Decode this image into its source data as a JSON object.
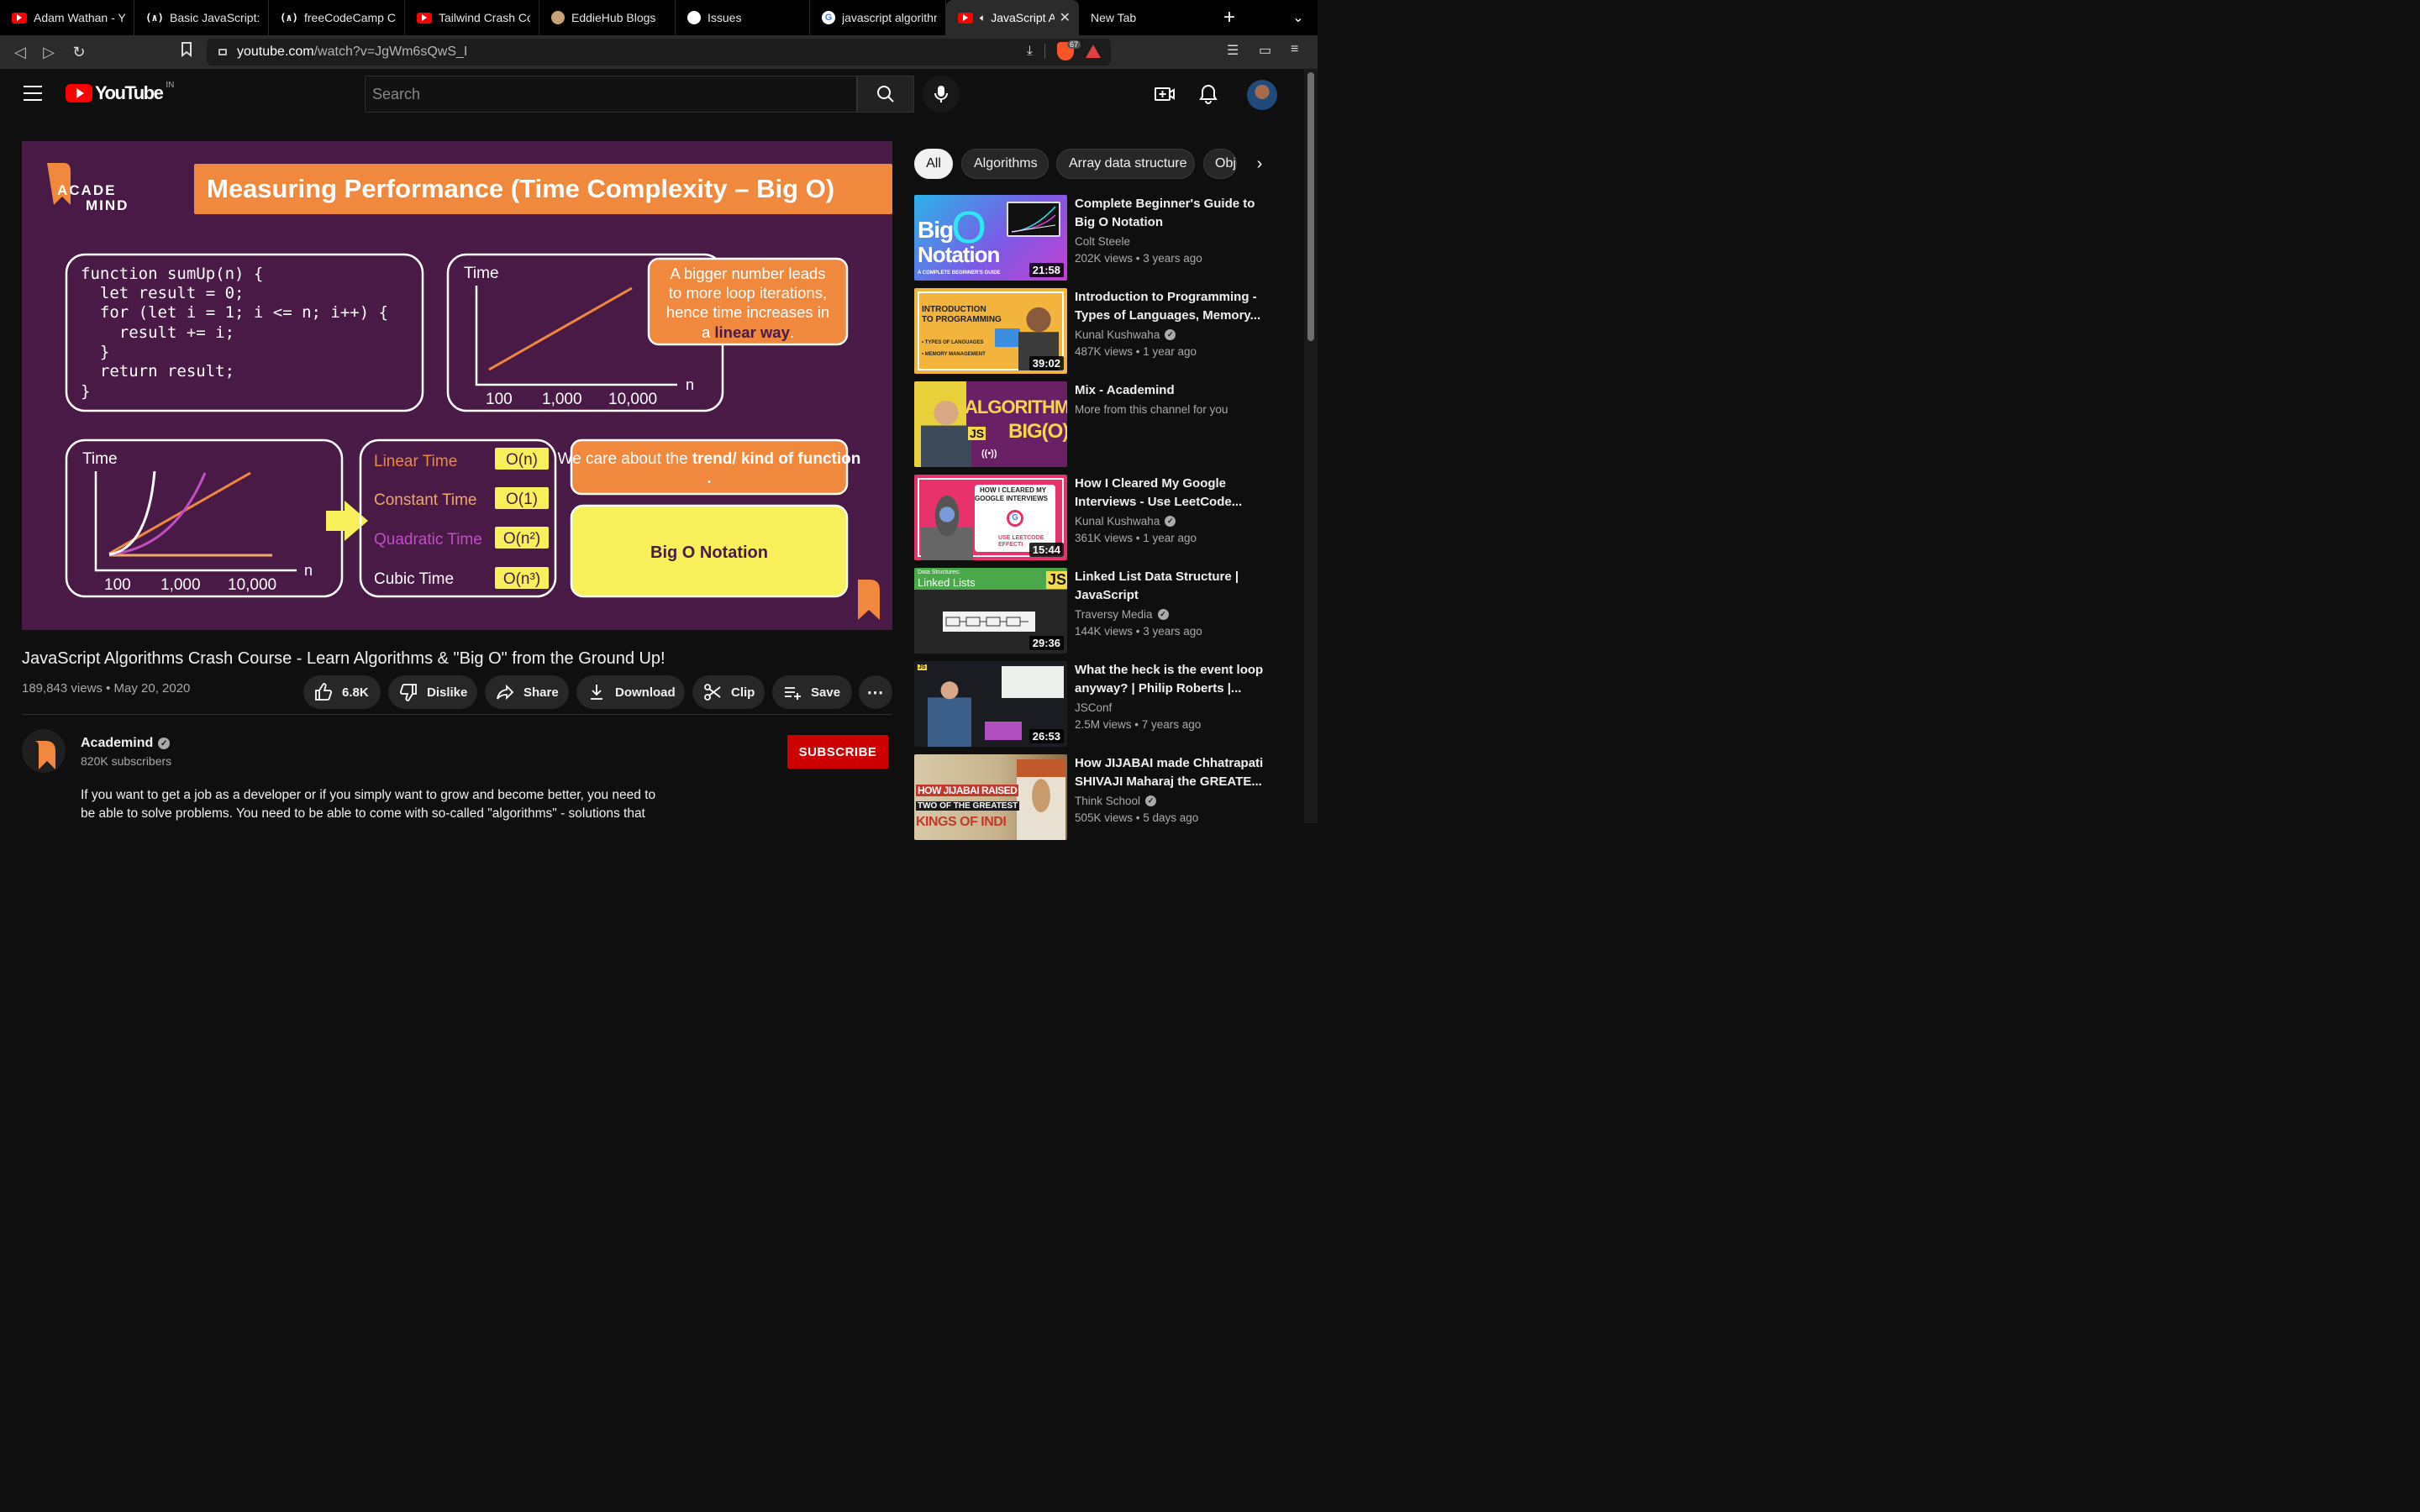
{
  "browser": {
    "tabs": [
      {
        "label": "Adam Wathan - You",
        "icon": "youtube-icon"
      },
      {
        "label": "Basic JavaScript: U",
        "icon": "freecodecamp-icon"
      },
      {
        "label": "freeCodeCamp Cha",
        "icon": "freecodecamp-icon"
      },
      {
        "label": "Tailwind Crash Cour",
        "icon": "youtube-icon"
      },
      {
        "label": "EddieHub Blogs",
        "icon": "eddiehub-icon"
      },
      {
        "label": "Issues",
        "icon": "github-icon"
      },
      {
        "label": "javascript algorithm",
        "icon": "google-icon"
      },
      {
        "label": "JavaScript A",
        "icon": "youtube-icon",
        "active": true
      },
      {
        "label": "New Tab",
        "icon": ""
      }
    ],
    "fcc_glyph": "(∧)",
    "url_host": "youtube.com",
    "url_path": "/watch?v=JgWm6sQwS_I",
    "shield_count": "67"
  },
  "youtube": {
    "logo_text": "YouTube",
    "country": "IN",
    "search_placeholder": "Search"
  },
  "video": {
    "slide": {
      "logo_line1": "ACADE",
      "logo_line2": "MIND",
      "heading": "Measuring Performance (Time Complexity – Big O)",
      "code": [
        "function sumUp(n) {",
        "  let result = 0;",
        "  for (let i = 1; i <= n; i++) {",
        "    result += i;",
        "  }",
        "  return result;",
        "}"
      ],
      "graph1": {
        "ylabel": "Time",
        "xlabel": "n",
        "ticks": [
          "100",
          "1,000",
          "10,000"
        ]
      },
      "note_lines": [
        "A bigger number leads",
        "to more loop iterations,",
        "hence time increases in",
        "a "
      ],
      "note_highlight": "linear way",
      "note_end": ".",
      "graph2": {
        "ylabel": "Time",
        "xlabel": "n",
        "ticks": [
          "100",
          "1,000",
          "10,000"
        ]
      },
      "complexities": [
        {
          "name": "Linear Time",
          "notation": "O(n)",
          "color": "#f0883e"
        },
        {
          "name": "Constant Time",
          "notation": "O(1)",
          "color": "#f0a868"
        },
        {
          "name": "Quadratic Time",
          "notation": "O(n²)",
          "color": "#c04fc4"
        },
        {
          "name": "Cubic Time",
          "notation": "O(n³)",
          "color": "#ffffff"
        }
      ],
      "care_prefix": "We care about the ",
      "care_bold": "trend/ kind of function",
      "care_end": ".",
      "bigo": "Big O Notation"
    },
    "title": "JavaScript Algorithms Crash Course - Learn Algorithms & \"Big O\" from the Ground Up!",
    "views": "189,843 views",
    "date": "May 20, 2020",
    "actions": {
      "likes": "6.8K",
      "dislike": "Dislike",
      "share": "Share",
      "download": "Download",
      "clip": "Clip",
      "save": "Save"
    },
    "channel": {
      "name": "Academind",
      "subscribers": "820K subscribers",
      "subscribe_label": "SUBSCRIBE"
    },
    "description_lines": [
      "If you want to get a job as a developer or if you simply want to grow and become better, you need to",
      "be able to solve problems. You need to be able to come with so-called \"algorithms\" - solutions that"
    ]
  },
  "chips": [
    "All",
    "Algorithms",
    "Array data structure",
    "Obj"
  ],
  "recommendations": [
    {
      "title": "Complete Beginner's Guide to Big O Notation",
      "channel": "Colt Steele",
      "verified": false,
      "meta": "202K views • 3 years ago",
      "duration": "21:58",
      "thumb_text": [
        "Big",
        "Notation",
        "A COMPLETE BEGINNER'S GUIDE"
      ]
    },
    {
      "title": "Introduction to Programming - Types of Languages, Memory...",
      "channel": "Kunal Kushwaha",
      "verified": true,
      "meta": "487K views • 1 year ago",
      "duration": "39:02",
      "thumb_text": [
        "INTRODUCTION",
        "TO PROGRAMMING",
        "• TYPES OF LANGUAGES",
        "• MEMORY MANAGEMENT"
      ]
    },
    {
      "title": "Mix - Academind",
      "channel": "More from this channel for you",
      "verified": false,
      "meta": "",
      "duration": "",
      "thumb_text": [
        "ALGORITHMS",
        "BIG(O)",
        "JS",
        "((•))"
      ]
    },
    {
      "title": "How I Cleared My Google Interviews - Use LeetCode...",
      "channel": "Kunal Kushwaha",
      "verified": true,
      "meta": "361K views • 1 year ago",
      "duration": "15:44",
      "thumb_text": [
        "HOW I CLEARED MY",
        "GOOGLE INTERVIEWS",
        "USE LEETCODE",
        "EFFECTI"
      ]
    },
    {
      "title": "Linked List Data Structure | JavaScript",
      "channel": "Traversy Media",
      "verified": true,
      "meta": "144K views • 3 years ago",
      "duration": "29:36",
      "thumb_text": [
        "Data Structures:",
        "Linked Lists",
        "JS"
      ]
    },
    {
      "title": "What the heck is the event loop anyway? | Philip Roberts |...",
      "channel": "JSConf",
      "verified": false,
      "meta": "2.5M views • 7 years ago",
      "duration": "26:53",
      "thumb_text": [
        "JS"
      ]
    },
    {
      "title": "How JIJABAI made Chhatrapati SHIVAJI Maharaj the GREATE...",
      "channel": "Think School",
      "verified": true,
      "meta": "505K views • 5 days ago",
      "duration": "",
      "thumb_text": [
        "HOW JIJABAI RAISED",
        "TWO OF THE GREATEST",
        "KINGS OF INDI"
      ]
    }
  ]
}
